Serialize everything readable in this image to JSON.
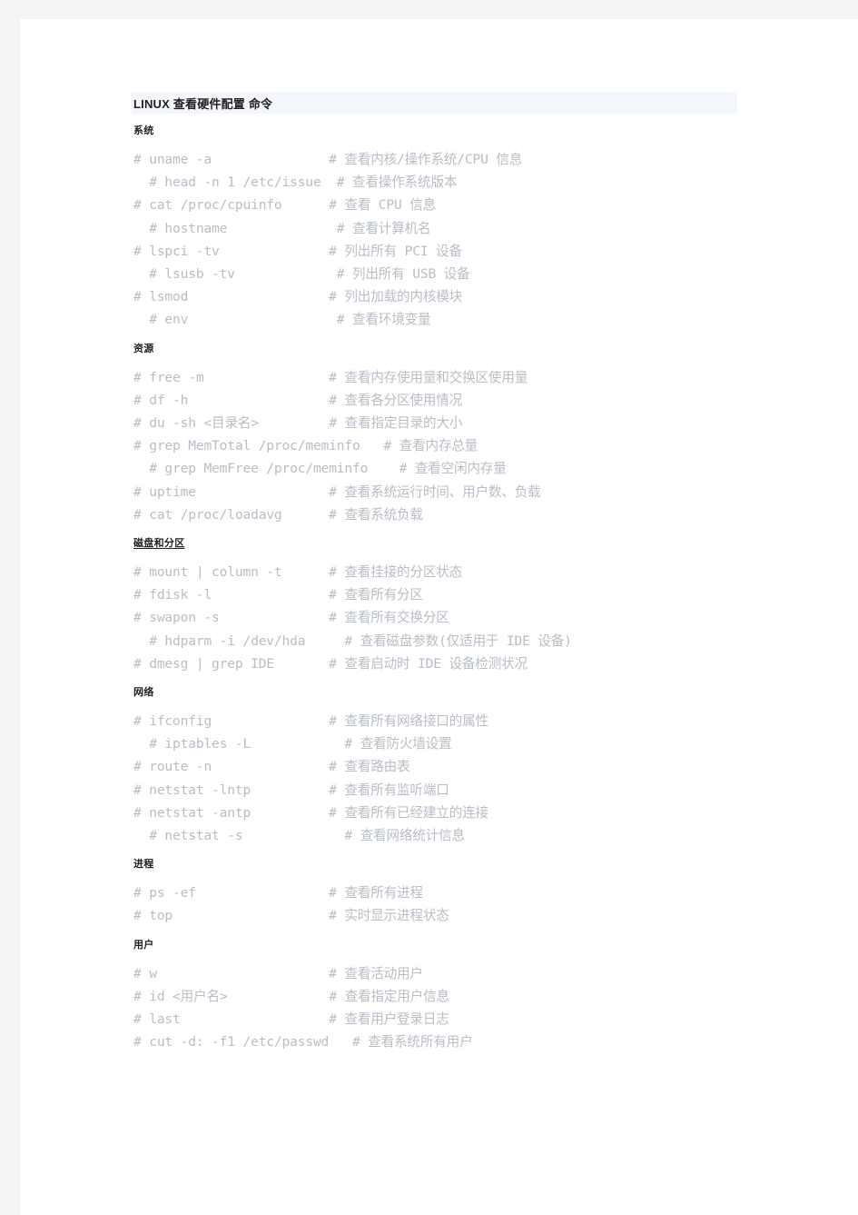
{
  "document": {
    "title": "LINUX 查看硬件配置 命令",
    "sections": [
      {
        "heading": "系统",
        "underlined": false,
        "lines": [
          "# uname -a               # 查看内核/操作系统/CPU 信息",
          "  # head -n 1 /etc/issue  # 查看操作系统版本",
          "# cat /proc/cpuinfo      # 查看 CPU 信息",
          "  # hostname              # 查看计算机名",
          "# lspci -tv              # 列出所有 PCI 设备",
          "  # lsusb -tv             # 列出所有 USB 设备",
          "# lsmod                  # 列出加载的内核模块",
          "  # env                   # 查看环境变量"
        ]
      },
      {
        "heading": "资源",
        "underlined": false,
        "lines": [
          "# free -m                # 查看内存使用量和交换区使用量",
          "# df -h                  # 查看各分区使用情况",
          "# du -sh <目录名>         # 查看指定目录的大小",
          "# grep MemTotal /proc/meminfo   # 查看内存总量",
          "  # grep MemFree /proc/meminfo    # 查看空闲内存量",
          "# uptime                 # 查看系统运行时间、用户数、负载",
          "# cat /proc/loadavg      # 查看系统负载"
        ]
      },
      {
        "heading": "磁盘和分区",
        "underlined": true,
        "lines": [
          "# mount | column -t      # 查看挂接的分区状态",
          "# fdisk -l               # 查看所有分区",
          "# swapon -s              # 查看所有交换分区",
          "  # hdparm -i /dev/hda     # 查看磁盘参数(仅适用于 IDE 设备)",
          "# dmesg | grep IDE       # 查看启动时 IDE 设备检测状况"
        ]
      },
      {
        "heading": "网络",
        "underlined": false,
        "lines": [
          "# ifconfig               # 查看所有网络接口的属性",
          "  # iptables -L            # 查看防火墙设置",
          "# route -n               # 查看路由表",
          "# netstat -lntp          # 查看所有监听端口",
          "# netstat -antp          # 查看所有已经建立的连接",
          "  # netstat -s             # 查看网络统计信息"
        ]
      },
      {
        "heading": "进程",
        "underlined": false,
        "lines": [
          "# ps -ef                 # 查看所有进程",
          "# top                    # 实时显示进程状态"
        ]
      },
      {
        "heading": "用户",
        "underlined": false,
        "lines": [
          "# w                      # 查看活动用户",
          "# id <用户名>             # 查看指定用户信息",
          "# last                   # 查看用户登录日志",
          "# cut -d: -f1 /etc/passwd   # 查看系统所有用户"
        ]
      }
    ]
  }
}
